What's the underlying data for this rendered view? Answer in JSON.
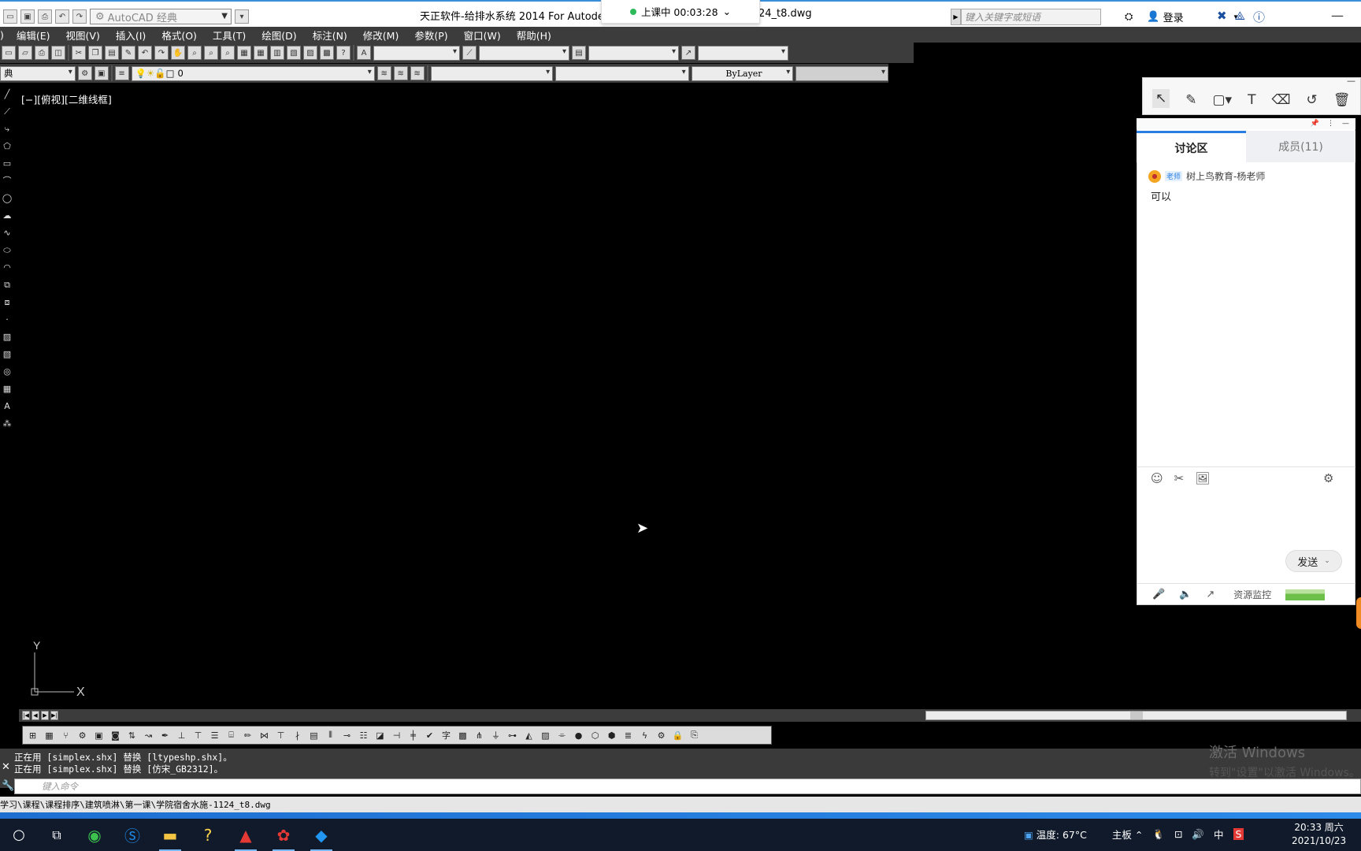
{
  "title": {
    "workspace": "AutoCAD 经典",
    "app_title": "天正软件-给排水系统 2014 For Autodesk",
    "file_suffix": "24_t8.dwg",
    "search_placeholder": "键入关键字或短语",
    "login": "登录"
  },
  "class_timer": {
    "status": "上课中 00:03:28"
  },
  "menu": [
    "编辑(E)",
    "视图(V)",
    "插入(I)",
    "格式(O)",
    "工具(T)",
    "绘图(D)",
    "标注(N)",
    "修改(M)",
    "参数(P)",
    "窗口(W)",
    "帮助(H)"
  ],
  "menu_partial": ")",
  "toolbar2": {
    "workspace_partial": "典",
    "layer_name": "0",
    "linetype": "ByLayer"
  },
  "viewport": {
    "label": "[−][俯视][二维线框]",
    "ucs_x": "X",
    "ucs_y": "Y"
  },
  "command": {
    "line1": "正在用 [simplex.shx] 替换 [ltypeshp.shx]。",
    "line2": "正在用 [simplex.shx] 替换 [仿宋_GB2312]。",
    "placeholder": "键入命令"
  },
  "status_path": "学习\\课程\\课程排序\\建筑喷淋\\第一课\\学院宿舍水施-1124_t8.dwg",
  "chat": {
    "tabs": [
      "讨论区",
      "成员(11)"
    ],
    "sender_badge": "老师",
    "sender_name": "树上鸟教育-杨老师",
    "message": "可以",
    "send_label": "发送",
    "resource_label": "资源监控"
  },
  "watermark": {
    "line1": "激活 Windows",
    "line2": "转到\"设置\"以激活 Windows。"
  },
  "tray": {
    "temperature": "温度: 67°C",
    "board": "主板",
    "ime": "中"
  },
  "clock": {
    "time": "20:33 周六",
    "date": "2021/10/23"
  },
  "colors": {
    "accent": "#2a7de1",
    "cad_bg": "#000000",
    "toolbar": "#3c3c3c",
    "taskbar": "#101a2a"
  }
}
